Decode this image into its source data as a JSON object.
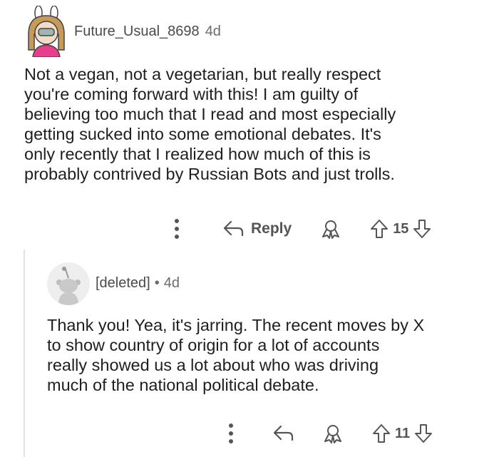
{
  "comment": {
    "username": "Future_Usual_8698",
    "time": "4d",
    "text": "Not a vegan, not a vegetarian, but really respect\nyou're coming forward with this! I am guilty of\nbelieving too much that I read and most especially\ngetting sucked into some emotional debates. It's\nonly recently that I realized how much of this is\nprobably contrived by Russian Bots and just trolls.",
    "reply_label": "Reply",
    "votes": "15"
  },
  "reply": {
    "username": "[deleted]",
    "separator": "•",
    "time": "4d",
    "text": "Thank you! Yea, it's jarring. The recent moves by X\nto show country of origin for a lot of accounts\nreally showed us a lot about who was driving\nmuch of the national political debate.",
    "votes": "11"
  },
  "icons": {
    "more": "more-vertical-icon",
    "reply": "reply-arrow-icon",
    "award": "award-icon",
    "upvote": "upvote-arrow-icon",
    "downvote": "downvote-arrow-icon"
  },
  "colors": {
    "text": "#1f1f1f",
    "meta": "#555555",
    "thread_line": "#e3e3e3",
    "avatar_pink": "#e83f8a"
  }
}
